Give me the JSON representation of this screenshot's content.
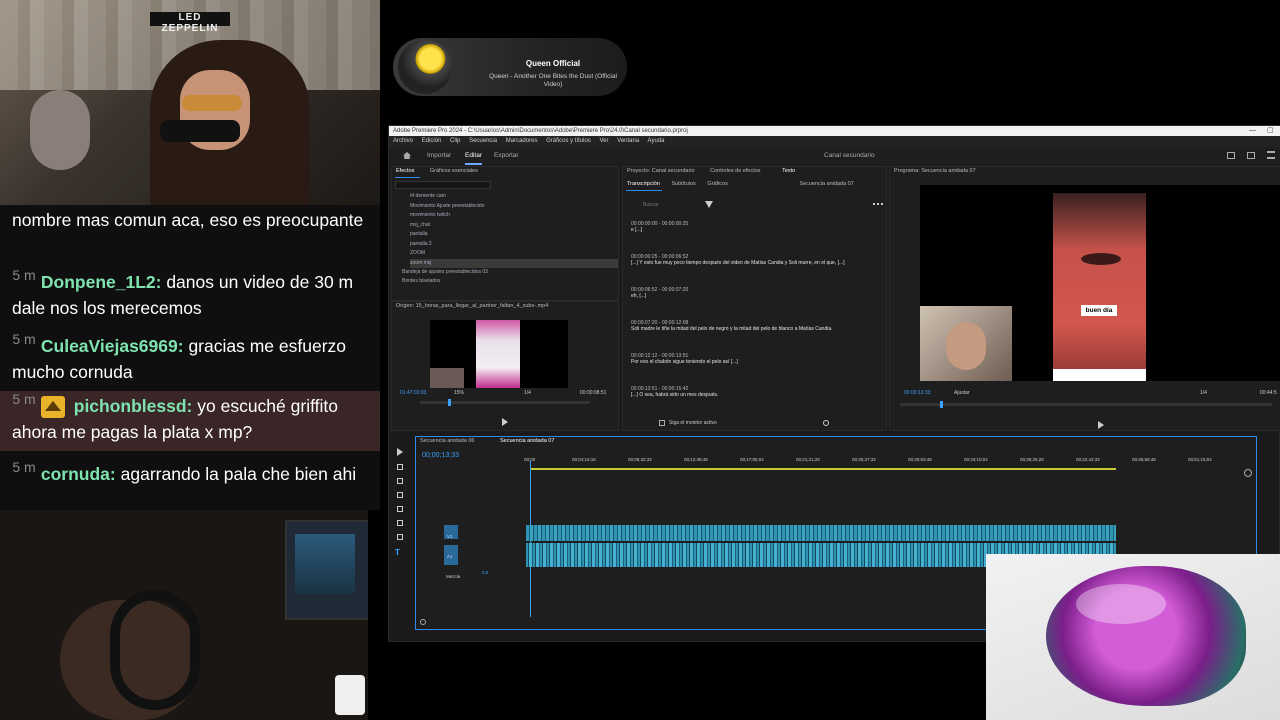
{
  "webcam": {
    "poster_text": "LED ZEPPELIN"
  },
  "now_playing": {
    "artist": "Queen Official",
    "title": "Queen - Another One Bites the Dust (Official Video)"
  },
  "chat": {
    "messages": [
      {
        "age": "",
        "user": "",
        "text": "nombre mas comun aca, eso es preocupante"
      },
      {
        "age": "5 m",
        "user": "Donpene_1L2:",
        "text": "danos un video de 30 m dale nos los merecemos"
      },
      {
        "age": "5 m",
        "user": "CuleaViejas6969:",
        "text": "gracias me esfuerzo mucho cornuda"
      },
      {
        "age": "5 m",
        "user": "pichonblessd:",
        "text": "yo escuché griffito ahora me pagas la plata x mp?",
        "highlight": true
      },
      {
        "age": "5 m",
        "user": "cornuda:",
        "text": "agarrando la pala che bien ahi"
      }
    ]
  },
  "premiere": {
    "title": "Adobe Premiere Pro 2024 - C:\\Usuarios\\Admin\\Documentos\\Adobe\\Premiere Pro\\24.0\\Canal secundario.prproj",
    "menu": [
      "Archivo",
      "Edición",
      "Clip",
      "Secuencia",
      "Marcadores",
      "Gráficos y títulos",
      "Ver",
      "Ventana",
      "Ayuda"
    ],
    "workspace_tabs": [
      "Importar",
      "Editar",
      "Exportar"
    ],
    "project_name": "Canal secundario",
    "effects": {
      "tabs": [
        "Efectos",
        "Gráficos esenciales"
      ],
      "items": [
        "t4 demente cam",
        "Movimiento Ajuste preestablecido",
        "movimiento twitch",
        "msj_chat",
        "pantalla",
        "pantalla 2",
        "ZOOM",
        "zoom msj",
        "Bandeja de ajustes preestablecidos 03",
        "Bordes biselados"
      ]
    },
    "source": {
      "header": "Origen: 15_horas_para_llegar_al_partner_faltan_4_subs-.mp4",
      "timecode": "01:47:03:03",
      "zoom": "15%",
      "fraction": "1/4",
      "duration": "00:00:08:51"
    },
    "text_panel": {
      "tabs": [
        "Proyecto: Canal secundario",
        "Controles de efectos",
        "Texto"
      ],
      "subtabs": [
        "Transcripción",
        "Subtítulos",
        "Gráficos"
      ],
      "sequence": "Secuencia anidada 07",
      "search_placeholder": "Buscar",
      "segments": [
        {
          "time": "00:00:00:00 - 00:00:00:25",
          "text": "e [...]"
        },
        {
          "time": "00:00:00:25 - 00:00:06:52",
          "text": "[...] Y esto fue muy poco tiempo después del video de Matías Candia y Soli murre, en el que, [...]"
        },
        {
          "time": "00:00:06:52 - 00:00:07:20",
          "text": "eh, [...]"
        },
        {
          "time": "00:00:07:20 - 00:00:12:08",
          "text": "Soli madre le tiñe la mitad del pelo de negro y la mitad del pelo de blanco a Matías Candia."
        },
        {
          "time": "00:00:12:12 - 00:00:13:51",
          "text": "Por eso el chabón sigue teniendo el pelo así [...]"
        },
        {
          "time": "00:00:13:51 - 00:00:15:42",
          "text": "[...] O sea, habrá sido un mes después."
        }
      ],
      "monitor_label": "Siga el monitor activo"
    },
    "program": {
      "header": "Programa: Secuencia anidada 07",
      "timecode": "00:00:13:33",
      "fit": "Ajustar",
      "fraction": "1/4",
      "duration": "00:44:5",
      "caption": "buen día"
    },
    "timeline": {
      "tabs": [
        "Secuencia anidada 06",
        "Secuencia anidada 07"
      ],
      "timecode": "00;00;13;33",
      "ruler": [
        "00;00",
        "00;04;16;16",
        "00;08;32;32",
        "00;12;48;48",
        "00;17;05;04",
        "00;21;21;20",
        "00;25;37;32",
        "00;29;53;48",
        "00;34;10;04",
        "00;38;26;20",
        "00;42;42;32",
        "00;46;58;48",
        "00;51;15;04"
      ],
      "tracks": [
        "V1",
        "A1"
      ],
      "master_label": "Mezcla",
      "master_value": "0,0"
    }
  }
}
